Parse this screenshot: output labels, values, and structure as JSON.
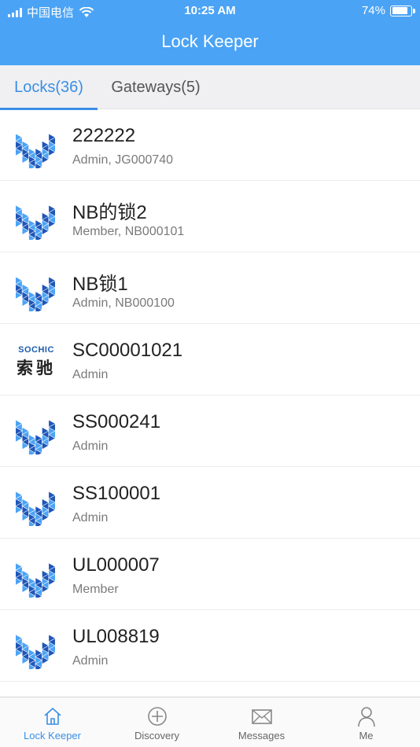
{
  "status_bar": {
    "carrier": "中国电信",
    "time": "10:25 AM",
    "battery": "74%"
  },
  "header": {
    "title": "Lock Keeper"
  },
  "tabs": [
    {
      "label": "Locks(36)",
      "active": true
    },
    {
      "label": "Gateways(5)",
      "active": false
    }
  ],
  "locks": [
    {
      "name": "222222",
      "subtitle": "Admin, JG000740",
      "logo": "lock-logo-icon"
    },
    {
      "name": "NB的锁2",
      "subtitle": "Member, NB000101",
      "logo": "lock-logo-icon"
    },
    {
      "name": "NB锁1",
      "subtitle": "Admin, NB000100",
      "logo": "lock-logo-icon"
    },
    {
      "name": "SC00001021",
      "subtitle": "Admin",
      "logo": "sochic-logo",
      "logo_text_en": "SOCHIC",
      "logo_text_cn": "索驰"
    },
    {
      "name": "SS000241",
      "subtitle": "Admin",
      "logo": "lock-logo-icon"
    },
    {
      "name": "SS100001",
      "subtitle": "Admin",
      "logo": "lock-logo-icon"
    },
    {
      "name": "UL000007",
      "subtitle": "Member",
      "logo": "lock-logo-icon"
    },
    {
      "name": "UL008819",
      "subtitle": "Admin",
      "logo": "lock-logo-icon"
    }
  ],
  "tabbar": [
    {
      "label": "Lock Keeper",
      "icon": "home-icon",
      "active": true
    },
    {
      "label": "Discovery",
      "icon": "plus-circle-icon",
      "active": false
    },
    {
      "label": "Messages",
      "icon": "envelope-icon",
      "active": false
    },
    {
      "label": "Me",
      "icon": "person-icon",
      "active": false
    }
  ],
  "colors": {
    "header": "#4aa3f5",
    "accent": "#3a8ee6",
    "logo_light": "#4aa3f5",
    "logo_dark": "#1f56b8"
  }
}
